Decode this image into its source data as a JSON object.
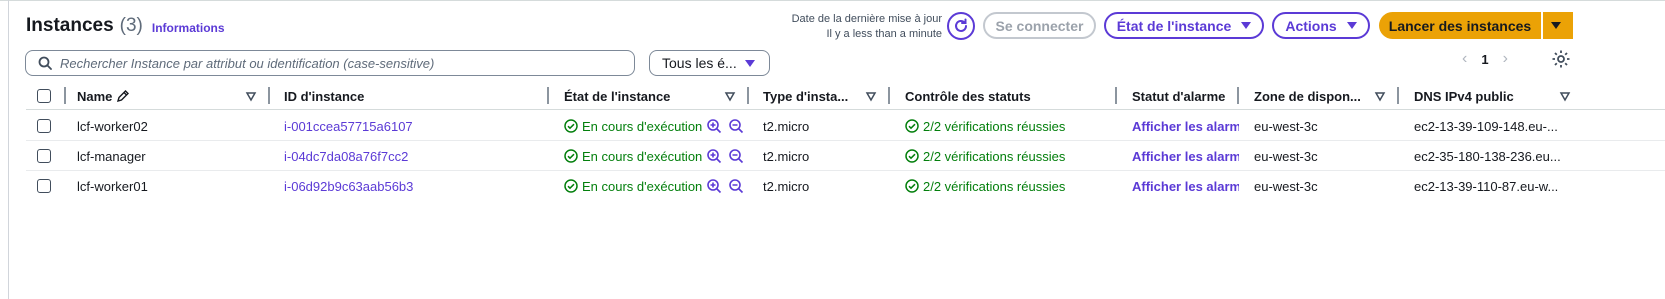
{
  "header": {
    "title": "Instances",
    "count": "(3)",
    "info_link": "Informations",
    "updated_line1": "Date de la dernière mise à jour",
    "updated_line2": "Il y a less than a minute"
  },
  "toolbar": {
    "connect_label": "Se connecter",
    "state_label": "État de l'instance",
    "actions_label": "Actions",
    "launch_label": "Lancer des instances"
  },
  "search": {
    "placeholder": "Rechercher Instance par attribut ou identification (case-sensitive)",
    "filter_value": "Tous les é..."
  },
  "pagination": {
    "current_page": "1",
    "prev": "‹",
    "next": "›"
  },
  "table": {
    "columns": {
      "name": "Name",
      "instance_id": "ID d'instance",
      "state": "État de l'instance",
      "type": "Type d'insta...",
      "status_check": "Contrôle des statuts",
      "alarm": "Statut d'alarme",
      "zone": "Zone de dispon...",
      "dns": "DNS IPv4 public"
    },
    "rows": [
      {
        "name": "lcf-worker02",
        "instance_id": "i-001ccea57715a6107",
        "state": "En cours d'exécution",
        "type": "t2.micro",
        "status_check": "2/2 vérifications réussies",
        "alarm": "Afficher les alarmes",
        "zone": "eu-west-3c",
        "dns": "ec2-13-39-109-148.eu-..."
      },
      {
        "name": "lcf-manager",
        "instance_id": "i-04dc7da08a76f7cc2",
        "state": "En cours d'exécution",
        "type": "t2.micro",
        "status_check": "2/2 vérifications réussies",
        "alarm": "Afficher les alarmes",
        "zone": "eu-west-3c",
        "dns": "ec2-35-180-138-236.eu..."
      },
      {
        "name": "lcf-worker01",
        "instance_id": "i-06d92b9c63aab56b3",
        "state": "En cours d'exécution",
        "type": "t2.micro",
        "status_check": "2/2 vérifications réussies",
        "alarm": "Afficher les alarmes",
        "zone": "eu-west-3c",
        "dns": "ec2-13-39-110-87.eu-w..."
      }
    ]
  },
  "icons": {
    "refresh": "refresh-icon",
    "search": "search-icon",
    "settings": "gear-icon",
    "edit": "pencil-icon",
    "sort": "sort-caret-icon",
    "success": "check-circle-icon",
    "zoom_in": "zoom-in-icon",
    "zoom_out": "zoom-out-icon"
  },
  "colors": {
    "accent": "#5b3ad6",
    "primary_button": "#eba206",
    "success": "#037f0c",
    "text": "#16191f",
    "muted": "#5f6b7a"
  }
}
